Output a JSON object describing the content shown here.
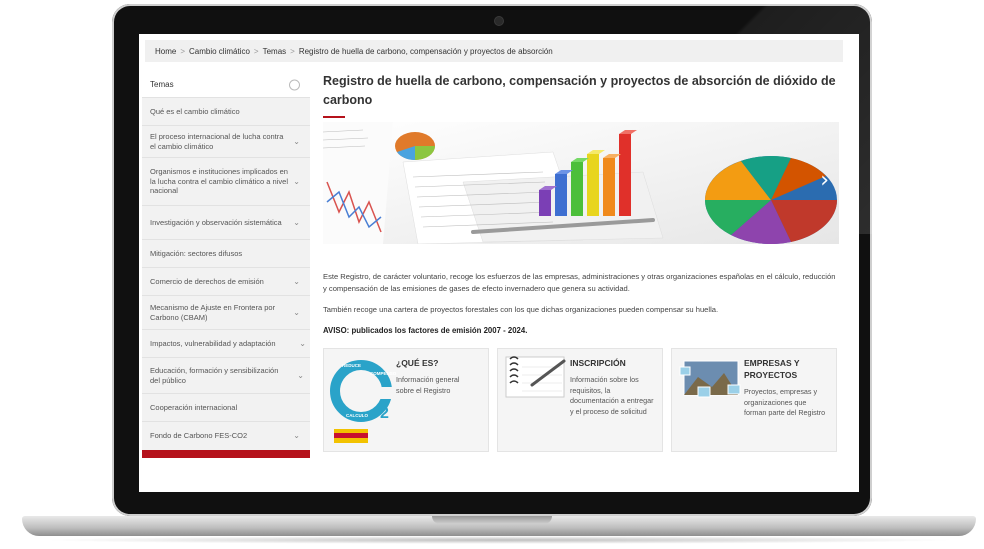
{
  "breadcrumb": [
    "Home",
    "Cambio climático",
    "Temas",
    "Registro de huella de carbono, compensación y proyectos de absorción"
  ],
  "breadcrumb_sep": ">",
  "sidebar": {
    "header": "Temas",
    "items": [
      {
        "label": "Qué es el cambio climático",
        "chevron": false
      },
      {
        "label": "El proceso internacional de lucha contra el cambio climático",
        "chevron": true
      },
      {
        "label": "Organismos e instituciones implicados en la lucha contra el cambio climático a nivel nacional",
        "chevron": true
      },
      {
        "label": "Investigación y observación sistemática",
        "chevron": true
      },
      {
        "label": "Mitigación: sectores difusos",
        "chevron": false
      },
      {
        "label": "Comercio de derechos de emisión",
        "chevron": true
      },
      {
        "label": "Mecanismo de Ajuste en Frontera por Carbono (CBAM)",
        "chevron": true
      },
      {
        "label": "Impactos, vulnerabilidad y adaptación",
        "chevron": true
      },
      {
        "label": "Educación, formación y sensibilización del público",
        "chevron": true
      },
      {
        "label": "Cooperación internacional",
        "chevron": false
      },
      {
        "label": "Fondo de Carbono FES-CO2",
        "chevron": true
      }
    ]
  },
  "main": {
    "title": "Registro de huella de carbono, compensación y proyectos de absorción de dióxido de carbono",
    "description": "Este Registro, de carácter voluntario, recoge los esfuerzos de las empresas, administraciones y otras organizaciones españolas en el cálculo, reducción y compensación de las emisiones de gases de efecto invernadero que genera su actividad.",
    "description2": "También recoge una cartera de proyectos forestales con los que dichas organizaciones pueden compensar su huella.",
    "aviso": "AVISO: publicados los factores de emisión 2007 - 2024.",
    "cards": [
      {
        "title": "¿QUÉ ES?",
        "text": "Información general sobre el Registro",
        "logo_lines": [
          "REDUCE",
          "COMPENSO",
          "CALCULO"
        ],
        "logo_suffix": "2"
      },
      {
        "title": "INSCRIPCIÓN",
        "text": "Información sobre los requisitos, la documentación a entregar y el proceso de solicitud"
      },
      {
        "title": "EMPRESAS Y PROYECTOS",
        "text": "Proyectos, empresas y organizaciones que forman parte del Registro"
      }
    ]
  },
  "colors": {
    "accent": "#b5121b",
    "sidebar_bg": "#f2f2f2",
    "breadcrumb_bg": "#f0f0f0",
    "logo_blue": "#2aa3c9"
  },
  "icons": {
    "carousel_next": "chevron-right-icon",
    "sidebar_chevron": "chevron-down-icon"
  }
}
